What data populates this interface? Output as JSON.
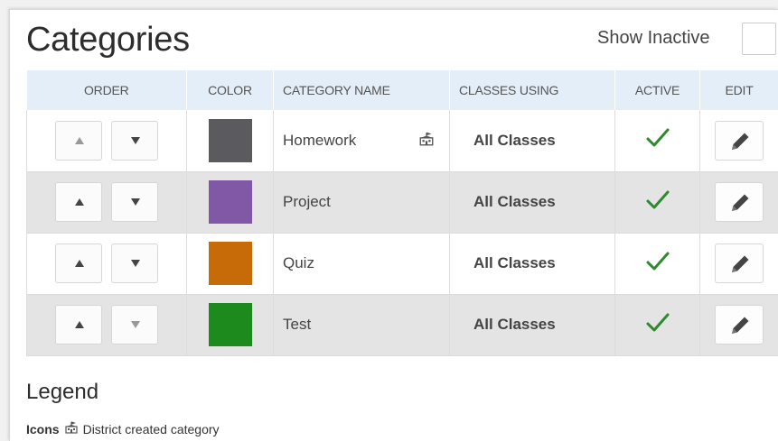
{
  "header": {
    "title": "Categories",
    "show_inactive_label": "Show Inactive"
  },
  "table": {
    "columns": [
      "ORDER",
      "COLOR",
      "CATEGORY NAME",
      "CLASSES USING",
      "ACTIVE",
      "EDIT"
    ],
    "rows": [
      {
        "name": "Homework",
        "classes": "All Classes",
        "color": "#5b5a5e",
        "active": true,
        "district_created": true,
        "up_enabled": false,
        "down_enabled": true
      },
      {
        "name": "Project",
        "classes": "All Classes",
        "color": "#8058a5",
        "active": true,
        "district_created": false,
        "up_enabled": true,
        "down_enabled": true
      },
      {
        "name": "Quiz",
        "classes": "All Classes",
        "color": "#c76b08",
        "active": true,
        "district_created": false,
        "up_enabled": true,
        "down_enabled": true
      },
      {
        "name": "Test",
        "classes": "All Classes",
        "color": "#1d8a1d",
        "active": true,
        "district_created": false,
        "up_enabled": true,
        "down_enabled": false
      }
    ]
  },
  "legend": {
    "title": "Legend",
    "icons_label": "Icons",
    "district_text": "District created category"
  },
  "colors": {
    "header_bg": "#e3eef8",
    "alt_row_bg": "#e4e4e4",
    "check_green": "#2f8a2f"
  },
  "icons": {
    "up": "triangle-up-icon",
    "down": "triangle-down-icon",
    "active": "checkmark-icon",
    "edit": "pencil-icon",
    "district": "school-building-icon"
  }
}
